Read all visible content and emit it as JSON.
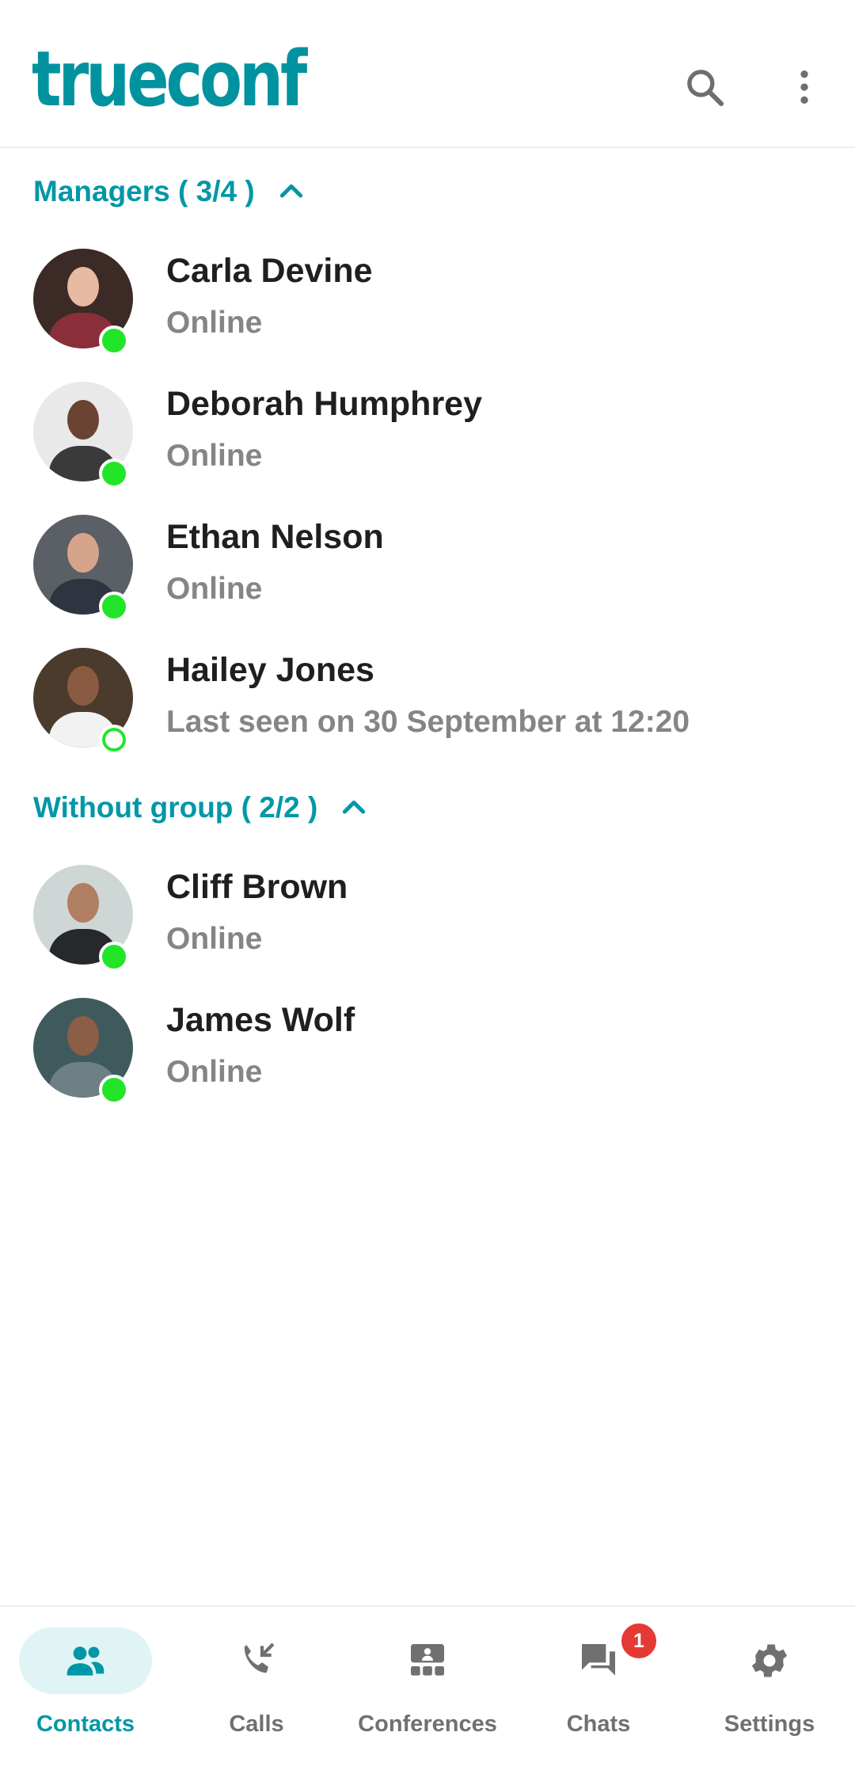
{
  "header": {
    "logo_text": "trueconf",
    "search_icon": "search-icon",
    "menu_icon": "more-vert-icon"
  },
  "groups": [
    {
      "label": "Managers ( 3/4 )",
      "expanded": true,
      "contacts": [
        {
          "name": "Carla Devine",
          "status": "Online",
          "presence": "online"
        },
        {
          "name": "Deborah Humphrey",
          "status": "Online",
          "presence": "online"
        },
        {
          "name": "Ethan Nelson",
          "status": "Online",
          "presence": "online"
        },
        {
          "name": "Hailey Jones",
          "status": "Last seen on 30 September at 12:20",
          "presence": "away"
        }
      ]
    },
    {
      "label": "Without group ( 2/2 )",
      "expanded": true,
      "contacts": [
        {
          "name": "Cliff Brown",
          "status": "Online",
          "presence": "online"
        },
        {
          "name": "James Wolf",
          "status": "Online",
          "presence": "online"
        }
      ]
    }
  ],
  "bottom_nav": {
    "items": [
      {
        "label": "Contacts",
        "icon": "contacts-icon",
        "active": true
      },
      {
        "label": "Calls",
        "icon": "phone-calls-icon",
        "active": false
      },
      {
        "label": "Conferences",
        "icon": "conferences-icon",
        "active": false
      },
      {
        "label": "Chats",
        "icon": "chat-icon",
        "active": false,
        "badge": "1"
      },
      {
        "label": "Settings",
        "icon": "gear-icon",
        "active": false
      }
    ]
  },
  "colors": {
    "accent": "#0097a7",
    "online": "#22e52a",
    "badge": "#e53935",
    "name_text": "#1f1f1f",
    "status_text": "#858585"
  }
}
